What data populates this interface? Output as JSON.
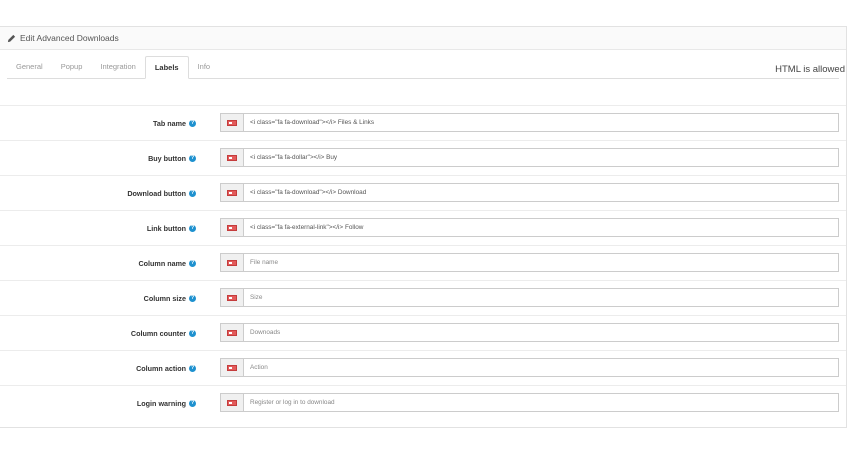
{
  "panel": {
    "title": "Edit Advanced Downloads"
  },
  "tabs": [
    {
      "label": "General"
    },
    {
      "label": "Popup"
    },
    {
      "label": "Integration"
    },
    {
      "label": "Labels"
    },
    {
      "label": "Info"
    }
  ],
  "html_note": "HTML is allowed",
  "help_glyph": "?",
  "fields": [
    {
      "label": "Tab name",
      "value": "<i class=\"fa fa-download\"></i> Files & Links",
      "placeholder": ""
    },
    {
      "label": "Buy button",
      "value": "<i class=\"fa fa-dollar\"></i> Buy",
      "placeholder": ""
    },
    {
      "label": "Download button",
      "value": "<i class=\"fa fa-download\"></i> Download",
      "placeholder": ""
    },
    {
      "label": "Link button",
      "value": "<i class=\"fa fa-external-link\"></i> Follow",
      "placeholder": ""
    },
    {
      "label": "Column name",
      "value": "",
      "placeholder": "File name"
    },
    {
      "label": "Column size",
      "value": "",
      "placeholder": "Size"
    },
    {
      "label": "Column counter",
      "value": "",
      "placeholder": "Downoads"
    },
    {
      "label": "Column action",
      "value": "",
      "placeholder": "Action"
    },
    {
      "label": "Login warning",
      "value": "",
      "placeholder": "Register or log in to download"
    }
  ],
  "colors": {
    "help_icon": "#1e91cf",
    "flag": "#e35a5a"
  }
}
